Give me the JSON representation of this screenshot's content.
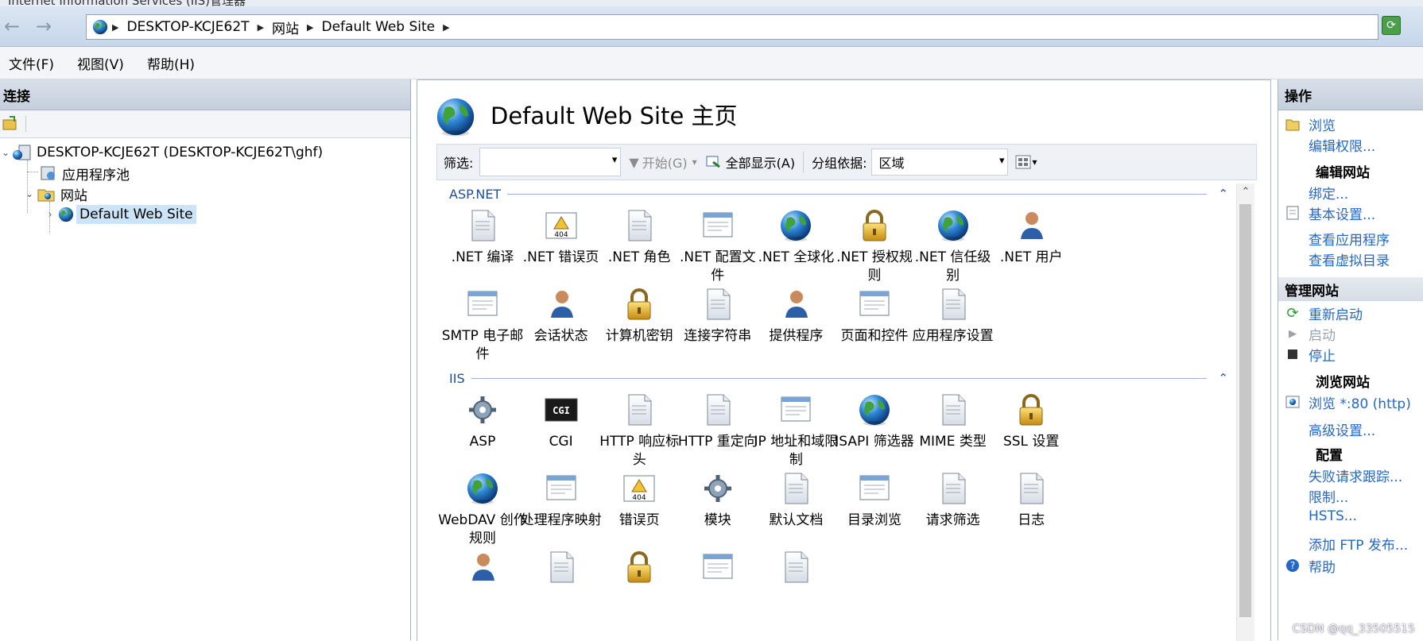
{
  "window": {
    "title": "Internet Information Services (IIS)管理器"
  },
  "address": {
    "crumbs": [
      "DESKTOP-KCJE62T",
      "网站",
      "Default Web Site"
    ]
  },
  "menu": [
    "文件(F)",
    "视图(V)",
    "帮助(H)"
  ],
  "connections": {
    "title": "连接",
    "tree": {
      "root": "DESKTOP-KCJE62T (DESKTOP-KCJE62T\\ghf)",
      "apppools": "应用程序池",
      "sites": "网站",
      "default_site": "Default Web Site"
    }
  },
  "page": {
    "title": "Default Web Site 主页",
    "filter_label": "筛选:",
    "filter_value": "",
    "start_label": "开始(G)",
    "show_all_label": "全部显示(A)",
    "group_by_label": "分组依据:",
    "group_by_value": "区域"
  },
  "groups": [
    {
      "name": "ASP.NET",
      "items": [
        {
          "label": ".NET 编译",
          "icon": "dotnet-compile-icon"
        },
        {
          "label": ".NET 错误页",
          "icon": "dotnet-error-pages-icon"
        },
        {
          "label": ".NET 角色",
          "icon": "dotnet-roles-icon"
        },
        {
          "label": ".NET 配置文件",
          "icon": "dotnet-profile-icon"
        },
        {
          "label": ".NET 全球化",
          "icon": "dotnet-globalization-icon"
        },
        {
          "label": ".NET 授权规则",
          "icon": "dotnet-authorization-icon"
        },
        {
          "label": ".NET 信任级别",
          "icon": "dotnet-trust-levels-icon"
        },
        {
          "label": ".NET 用户",
          "icon": "dotnet-users-icon"
        },
        {
          "label": "SMTP 电子邮件",
          "icon": "smtp-email-icon"
        },
        {
          "label": "会话状态",
          "icon": "session-state-icon"
        },
        {
          "label": "计算机密钥",
          "icon": "machine-key-icon"
        },
        {
          "label": "连接字符串",
          "icon": "connection-strings-icon"
        },
        {
          "label": "提供程序",
          "icon": "providers-icon"
        },
        {
          "label": "页面和控件",
          "icon": "pages-controls-icon"
        },
        {
          "label": "应用程序设置",
          "icon": "app-settings-icon"
        }
      ]
    },
    {
      "name": "IIS",
      "items": [
        {
          "label": "ASP",
          "icon": "asp-icon"
        },
        {
          "label": "CGI",
          "icon": "cgi-icon"
        },
        {
          "label": "HTTP 响应标头",
          "icon": "http-response-headers-icon"
        },
        {
          "label": "HTTP 重定向",
          "icon": "http-redirect-icon"
        },
        {
          "label": "IP 地址和域限制",
          "icon": "ip-domain-restrictions-icon"
        },
        {
          "label": "ISAPI 筛选器",
          "icon": "isapi-filters-icon"
        },
        {
          "label": "MIME 类型",
          "icon": "mime-types-icon"
        },
        {
          "label": "SSL 设置",
          "icon": "ssl-settings-icon"
        },
        {
          "label": "WebDAV 创作规则",
          "icon": "webdav-icon"
        },
        {
          "label": "处理程序映射",
          "icon": "handler-mappings-icon"
        },
        {
          "label": "错误页",
          "icon": "error-pages-icon"
        },
        {
          "label": "模块",
          "icon": "modules-icon"
        },
        {
          "label": "默认文档",
          "icon": "default-document-icon"
        },
        {
          "label": "目录浏览",
          "icon": "directory-browsing-icon"
        },
        {
          "label": "请求筛选",
          "icon": "request-filtering-icon"
        },
        {
          "label": "日志",
          "icon": "logging-icon"
        },
        {
          "label": "",
          "icon": "authentication-icon"
        },
        {
          "label": "",
          "icon": "failed-request-tracing-icon"
        },
        {
          "label": "",
          "icon": "authorization-rules-icon"
        },
        {
          "label": "",
          "icon": "output-caching-icon"
        },
        {
          "label": "",
          "icon": "compression-icon"
        }
      ]
    }
  ],
  "actions": {
    "title": "操作",
    "browse": "浏览",
    "edit_permissions": "编辑权限...",
    "edit_site_title": "编辑网站",
    "bindings": "绑定...",
    "basic_settings": "基本设置...",
    "view_applications": "查看应用程序",
    "view_virtual_dirs": "查看虚拟目录",
    "manage_site_title": "管理网站",
    "restart": "重新启动",
    "start": "启动",
    "stop": "停止",
    "browse_site_title": "浏览网站",
    "browse_80": "浏览 *:80 (http)",
    "advanced_settings": "高级设置...",
    "config_title": "配置",
    "failed_request_tracing": "失败请求跟踪...",
    "limits": "限制...",
    "hsts": "HSTS...",
    "add_ftp": "添加 FTP 发布...",
    "help": "帮助"
  },
  "watermark": "CSDN @qq_33505515",
  "colors": {
    "link": "#2468c5",
    "group_header": "#1d4f9c",
    "selection": "#cce4f7"
  }
}
